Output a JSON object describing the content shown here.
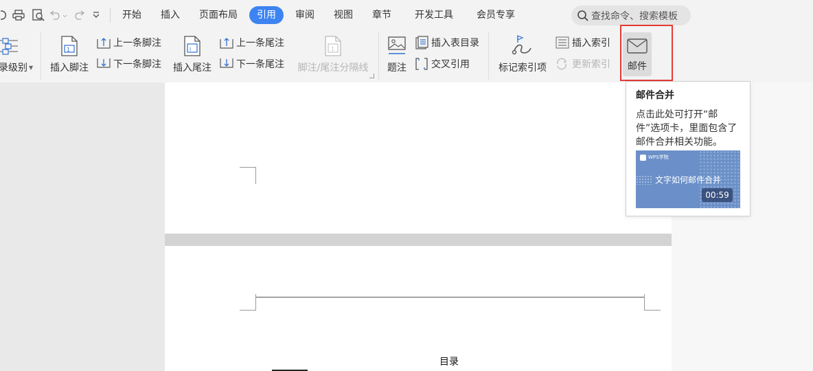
{
  "menu": {
    "tabs": [
      {
        "label": "开始"
      },
      {
        "label": "插入"
      },
      {
        "label": "页面布局"
      },
      {
        "label": "引用"
      },
      {
        "label": "审阅"
      },
      {
        "label": "视图"
      },
      {
        "label": "章节"
      },
      {
        "label": "开发工具"
      },
      {
        "label": "会员专享"
      }
    ],
    "active_tab": "引用",
    "search_placeholder": "查找命令、搜索模板"
  },
  "ribbon": {
    "toc_level": "录级别",
    "insert_footnote": "插入脚注",
    "prev_footnote": "上一条脚注",
    "next_footnote": "下一条脚注",
    "insert_endnote": "插入尾注",
    "prev_endnote": "上一条尾注",
    "next_endnote": "下一条尾注",
    "footnote_separator": "脚注/尾注分隔线",
    "caption": "题注",
    "insert_table_of_figures": "插入表目录",
    "cross_reference": "交叉引用",
    "mark_index_entry": "标记索引项",
    "insert_index": "插入索引",
    "update_index": "更新索引",
    "mail": "邮件"
  },
  "tooltip": {
    "title": "邮件合并",
    "body": "点击此处可打开“邮件”选项卡，里面包含了邮件合并相关功能。",
    "video_brand": "WPS学院",
    "video_title": "文字如何邮件合并",
    "video_duration": "00:59"
  },
  "document": {
    "toc_heading": "目录"
  },
  "colors": {
    "accent": "#3d84f2",
    "highlight_border": "#e53935",
    "video_bg": "#6b90c9"
  }
}
